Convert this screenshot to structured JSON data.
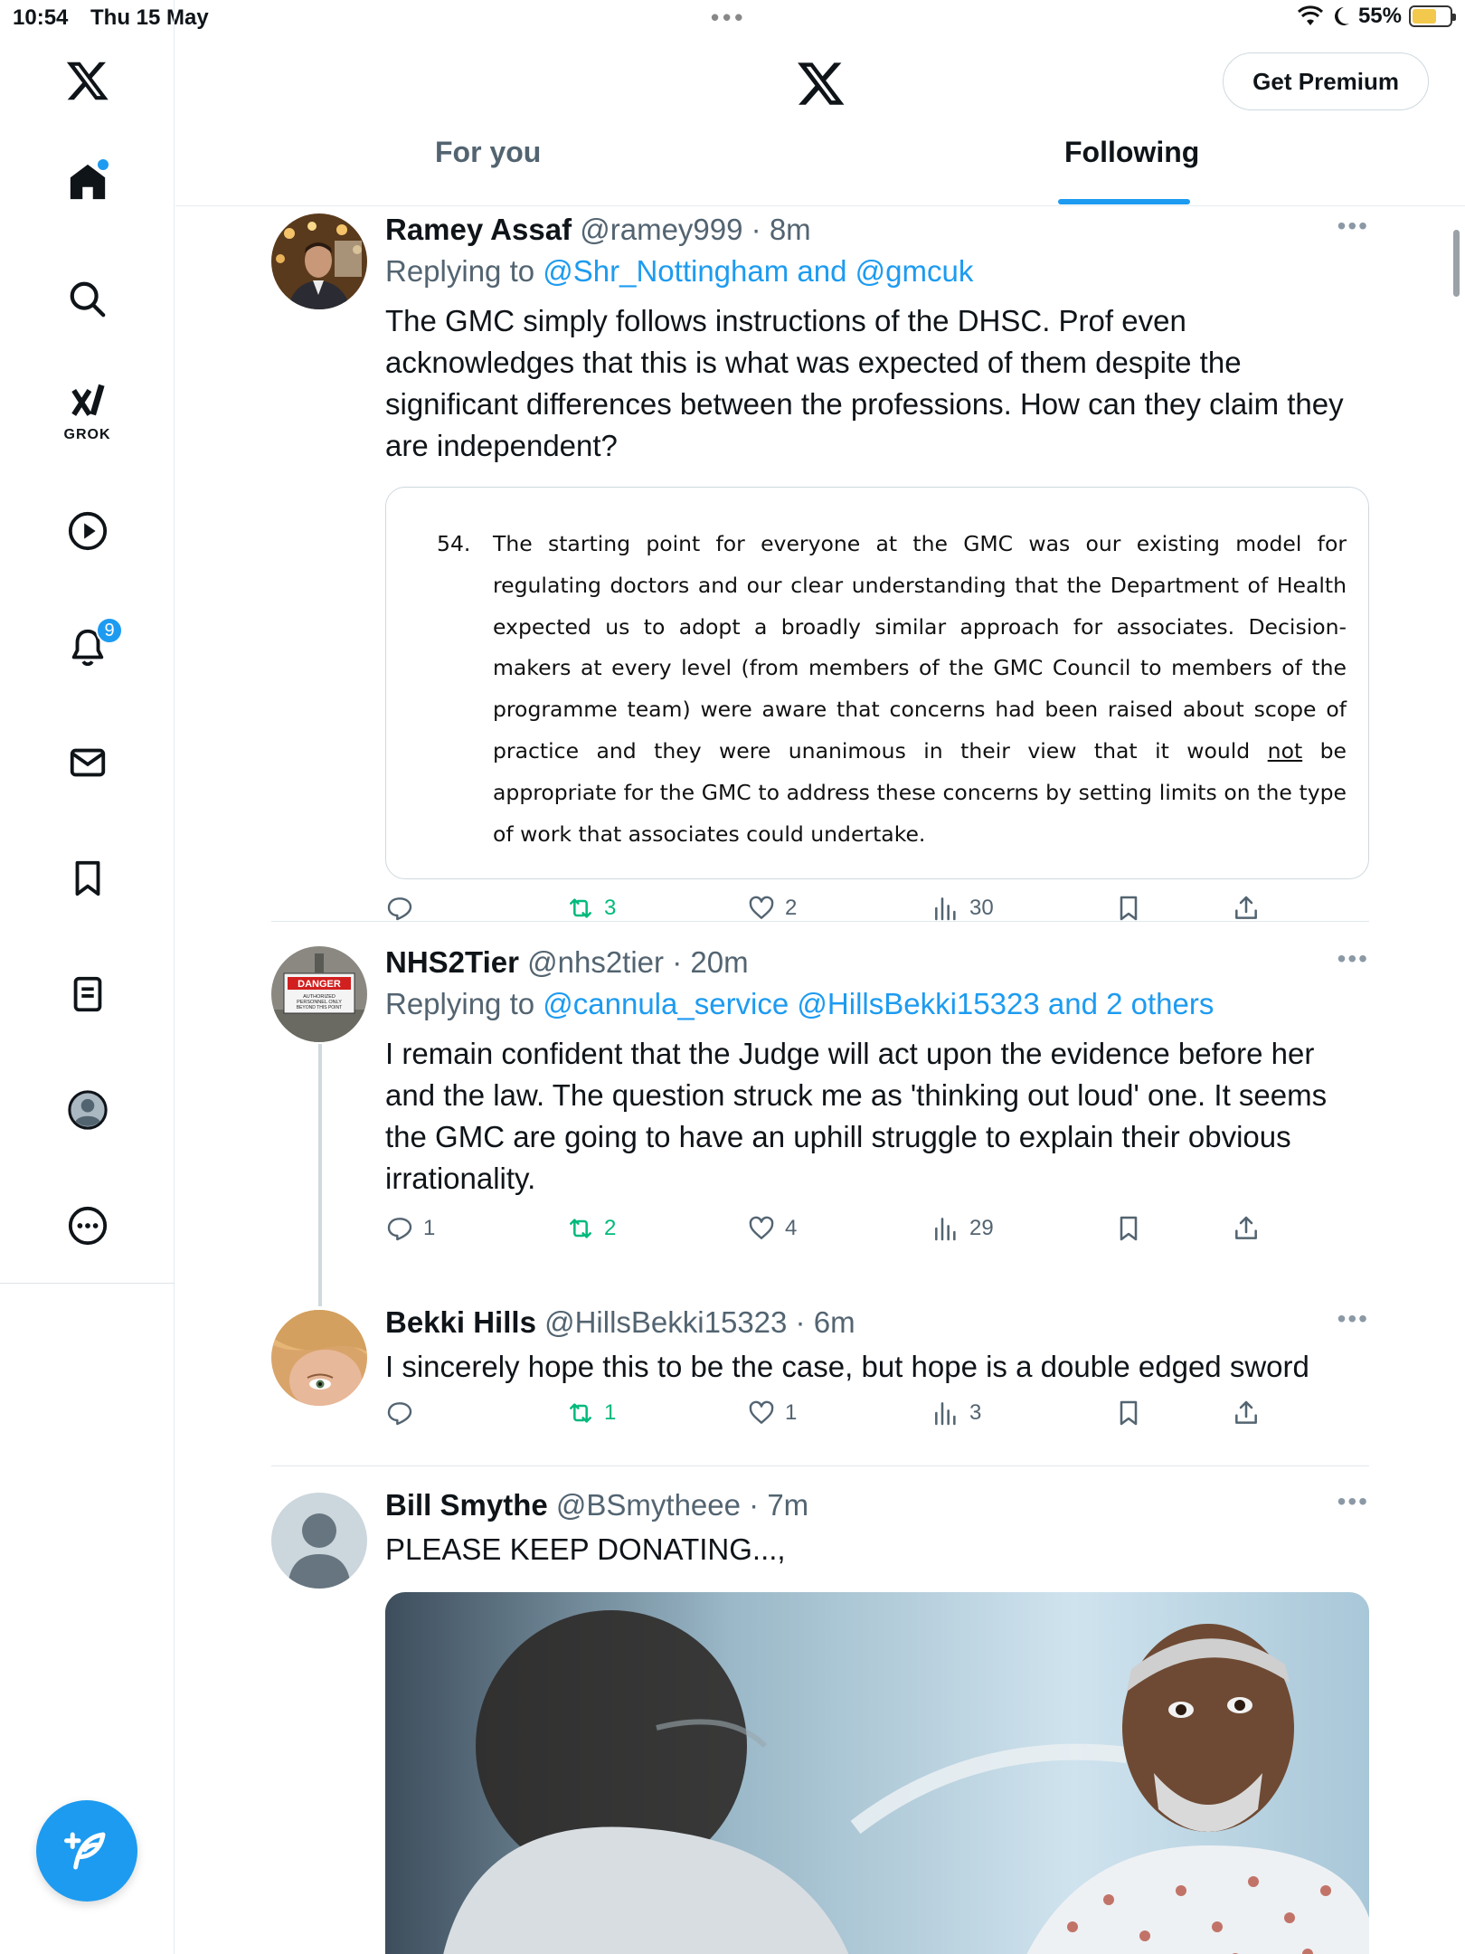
{
  "status_bar": {
    "time": "10:54",
    "date": "Thu 15 May",
    "battery": "55%"
  },
  "sidebar": {
    "notifications_count": "9",
    "grok_label": "GROK",
    "items": [
      "x-logo",
      "home-icon",
      "search-icon",
      "grok-icon",
      "video-icon",
      "notifications-icon",
      "messages-icon",
      "bookmarks-icon",
      "lists-icon",
      "profile-icon",
      "more-icon"
    ]
  },
  "header": {
    "premium_label": "Get Premium",
    "tabs": [
      {
        "label": "For you"
      },
      {
        "label": "Following"
      }
    ]
  },
  "tweets": [
    {
      "name": "Ramey Assaf",
      "handle": "@ramey999",
      "sep": " · ",
      "time": "8m",
      "replying_prefix": "Replying to ",
      "replying_to": "@Shr_Nottingham and @gmcuk",
      "text": "The GMC simply follows instructions of the DHSC. Prof even acknowledges that this is what was expected of them despite the significant differences between the professions. How can they claim they are independent?",
      "quote_number": "54.",
      "quote_text_before": "The starting point for everyone at the GMC was our existing model for regulating doctors and our clear understanding that the Department of Health expected us to adopt a broadly similar approach for associates. Decision-makers at every level (from members of the GMC Council to members of the programme team) were aware that concerns had been raised about scope of practice and they were unanimous in their view that it would ",
      "quote_text_underlined": "not",
      "quote_text_after": " be appropriate for the GMC to address these concerns by setting limits on the type of work that associates could undertake.",
      "replies": "",
      "retweets": "3",
      "likes": "2",
      "views": "30"
    },
    {
      "name": "NHS2Tier",
      "handle": "@nhs2tier",
      "sep": " · ",
      "time": "20m",
      "replying_prefix": "Replying to ",
      "replying_to": "@cannula_service @HillsBekki15323 and 2 others",
      "text": "I remain confident that the Judge will act upon the evidence before her and the law. The question struck me as 'thinking out loud' one. It seems the GMC are going to have an uphill struggle to explain their obvious irrationality.",
      "avatar_sign_title": "DANGER",
      "avatar_sign_text": "AUTHORIZED PERSONNEL ONLY BEYOND THIS POINT",
      "replies": "1",
      "retweets": "2",
      "likes": "4",
      "views": "29"
    },
    {
      "name": "Bekki Hills",
      "handle": "@HillsBekki15323",
      "sep": " · ",
      "time": "6m",
      "text": "I sincerely hope this to be the case, but hope is a double edged sword",
      "replies": "",
      "retweets": "1",
      "likes": "1",
      "views": "3"
    },
    {
      "name": "Bill Smythe",
      "handle": "@BSmytheee",
      "sep": " · ",
      "time": "7m",
      "text": "PLEASE KEEP DONATING...,"
    }
  ],
  "colors": {
    "accent": "#1d9bf0",
    "retweet": "#00ba7c",
    "muted": "#536471"
  }
}
